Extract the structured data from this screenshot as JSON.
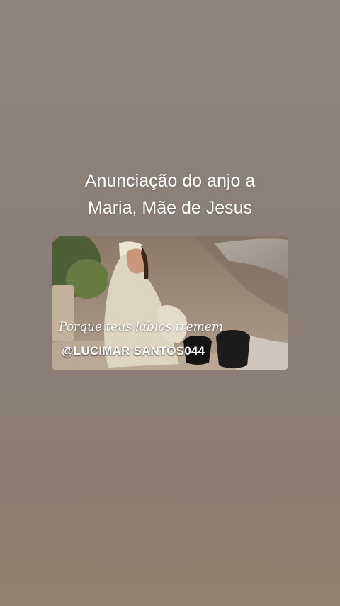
{
  "post": {
    "title_line1": "Anunciação do anjo a",
    "title_line2": "Maria, Mãe de Jesus"
  },
  "video": {
    "caption": "Porque teus lábios tremem",
    "watermark": "@LUCIMAR SANTOS044"
  },
  "colors": {
    "background": "#8a7f78",
    "title_text": "#ffffff"
  }
}
